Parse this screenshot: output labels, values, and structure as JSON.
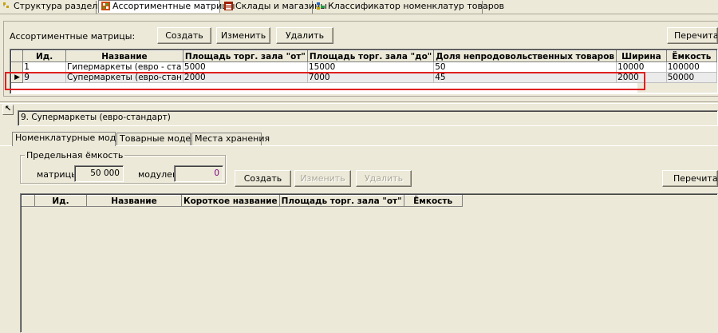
{
  "top_tabs": [
    {
      "label": "Структура разделов",
      "icon": "tree-icon"
    },
    {
      "label": "Ассортиментные матрицы",
      "icon": "matrix-icon"
    },
    {
      "label": "Склады и магазины",
      "icon": "store-icon"
    },
    {
      "label": "Классификатор номенклатур товаров",
      "icon": "classifier-icon"
    }
  ],
  "matrices": {
    "section_label": "Ассортиментные матрицы:",
    "create_label": "Создать",
    "edit_label": "Изменить",
    "delete_label": "Удалить",
    "refresh_label": "Перечитать",
    "columns": [
      "Ид.",
      "Название",
      "Площадь торг. зала \"от\"",
      "Площадь торг. зала \"до\"",
      "Доля непродовольственных товаров",
      "Ширина",
      "Ёмкость"
    ],
    "rows": [
      {
        "indicator": "",
        "id": "1",
        "name": "Гипермаркеты (евро - ста",
        "area_from": "5000",
        "area_to": "15000",
        "nonfood_share": "50",
        "width": "10000",
        "capacity": "100000"
      },
      {
        "indicator": "▶",
        "id": "9",
        "name": "Супермаркеты (евро-стан",
        "area_from": "2000",
        "area_to": "7000",
        "nonfood_share": "45",
        "width": "2000",
        "capacity": "50000"
      }
    ]
  },
  "detail": {
    "collapse_glyph": "↖",
    "title": "9. Супермаркеты (евро-стандарт)",
    "tabs": [
      "Номенклатурные модули",
      "Товарные модели",
      "Места хранения"
    ],
    "capacity_group": {
      "legend": "Предельная ёмкость",
      "matrix_label": "матрицы",
      "matrix_value": "50 000",
      "modules_label": "модулей",
      "modules_value": "0"
    },
    "create_label": "Создать",
    "edit_label": "Изменить",
    "delete_label": "Удалить",
    "refresh_label": "Перечитать",
    "columns": [
      "Ид.",
      "Название",
      "Короткое название",
      "Площадь торг. зала \"от\"",
      "Ёмкость"
    ]
  },
  "colors": {
    "highlight": "#e02020",
    "modules_value": "#800080"
  }
}
